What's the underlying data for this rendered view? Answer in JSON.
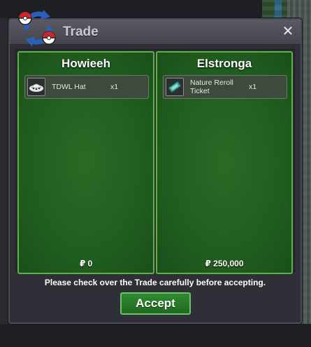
{
  "window": {
    "title": "Trade",
    "close_symbol": "✕"
  },
  "left_panel": {
    "name": "Howieeh",
    "items": [
      {
        "name": "TDWL Hat",
        "qty": "x1",
        "icon": "hat-icon"
      }
    ],
    "money": "₽ 0"
  },
  "right_panel": {
    "name": "Elstronga",
    "items": [
      {
        "name": "Nature Reroll Ticket",
        "qty": "x1",
        "icon": "ticket-icon"
      }
    ],
    "money": "₽ 250,000"
  },
  "notice": "Please check over the Trade carefully before accepting.",
  "accept_label": "Accept",
  "colors": {
    "panel_border": "#5fb046",
    "panel_bg": "#1f5a1e",
    "accept_bg": "#2f8a2f"
  }
}
